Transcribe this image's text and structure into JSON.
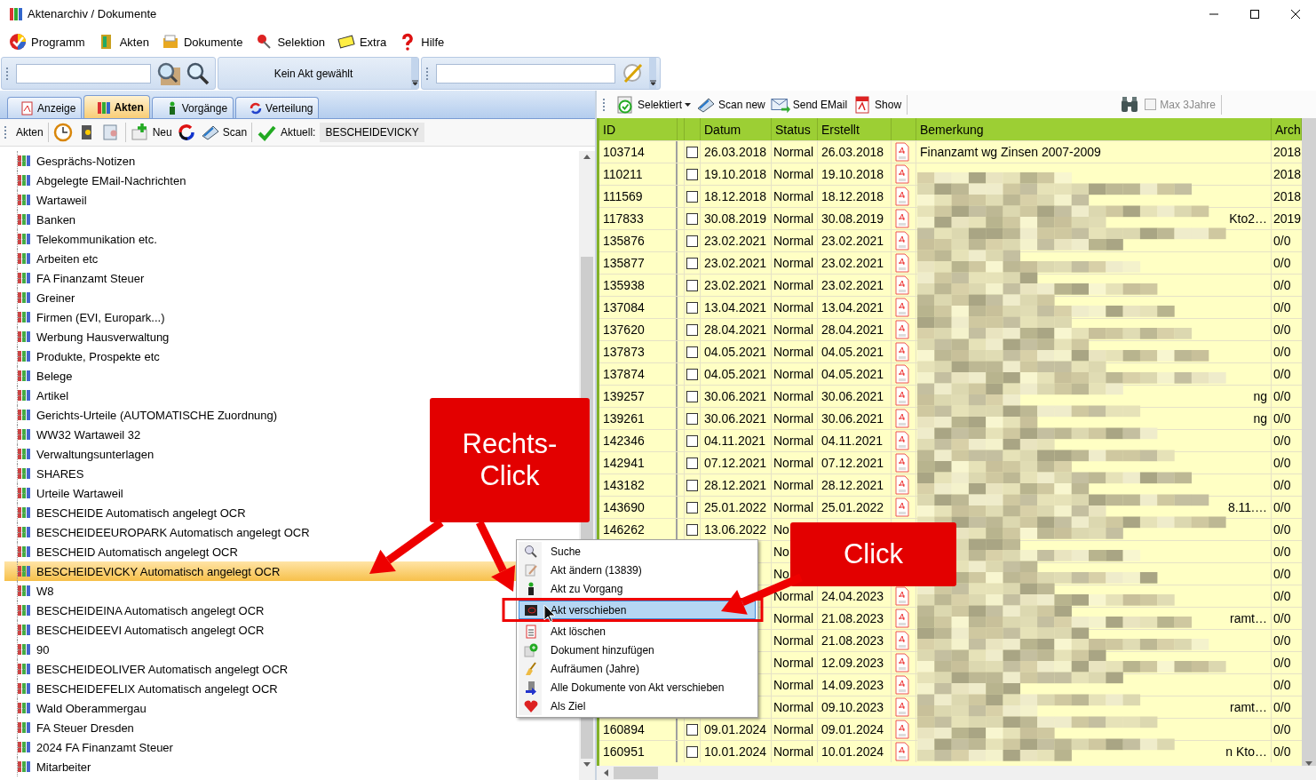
{
  "window": {
    "title": "Aktenarchiv / Dokumente"
  },
  "menu": [
    "Programm",
    "Akten",
    "Dokumente",
    "Selektion",
    "Extra",
    "Hilfe"
  ],
  "toolbar": {
    "status": "Kein Akt gewählt"
  },
  "tabs": [
    {
      "label": "Anzeige",
      "selected": false
    },
    {
      "label": "Akten",
      "selected": true
    },
    {
      "label": "Vorgänge",
      "selected": false
    },
    {
      "label": "Verteilung",
      "selected": false
    }
  ],
  "akten_toolbar": {
    "label": "Akten",
    "new": "Neu",
    "scan": "Scan",
    "current_label": "Aktuell:",
    "current_value": "BESCHEIDEVICKY"
  },
  "tree": [
    {
      "label": "Gesprächs-Notizen",
      "selected": false
    },
    {
      "label": "Abgelegte EMail-Nachrichten",
      "selected": false
    },
    {
      "label": "Wartaweil",
      "selected": false
    },
    {
      "label": "Banken",
      "selected": false
    },
    {
      "label": "Telekommunikation etc.",
      "selected": false
    },
    {
      "label": "Arbeiten etc",
      "selected": false
    },
    {
      "label": "FA Finanzamt Steuer",
      "selected": false
    },
    {
      "label": "Greiner",
      "selected": false
    },
    {
      "label": "Firmen (EVI, Europark...)",
      "selected": false
    },
    {
      "label": "Werbung Hausverwaltung",
      "selected": false
    },
    {
      "label": "Produkte, Prospekte etc",
      "selected": false
    },
    {
      "label": "Belege",
      "selected": false
    },
    {
      "label": "Artikel",
      "selected": false
    },
    {
      "label": "Gerichts-Urteile (AUTOMATISCHE Zuordnung)",
      "selected": false
    },
    {
      "label": "WW32 Wartaweil 32",
      "selected": false
    },
    {
      "label": "Verwaltungsunterlagen",
      "selected": false
    },
    {
      "label": "SHARES",
      "selected": false
    },
    {
      "label": "Urteile Wartaweil",
      "selected": false
    },
    {
      "label": "BESCHEIDE Automatisch angelegt OCR",
      "selected": false
    },
    {
      "label": "BESCHEIDEEUROPARK Automatisch angelegt OCR",
      "selected": false
    },
    {
      "label": "BESCHEID Automatisch angelegt OCR",
      "selected": false
    },
    {
      "label": "BESCHEIDEVICKY Automatisch angelegt OCR",
      "selected": true
    },
    {
      "label": "W8",
      "selected": false
    },
    {
      "label": "BESCHEIDEINA Automatisch angelegt OCR",
      "selected": false
    },
    {
      "label": "BESCHEIDEEVI Automatisch angelegt OCR",
      "selected": false
    },
    {
      "label": "90",
      "selected": false
    },
    {
      "label": "BESCHEIDEOLIVER Automatisch angelegt OCR",
      "selected": false
    },
    {
      "label": "BESCHEIDEFELIX Automatisch angelegt OCR",
      "selected": false
    },
    {
      "label": "Wald Oberammergau",
      "selected": false
    },
    {
      "label": "FA Steuer Dresden",
      "selected": false
    },
    {
      "label": "2024 FA Finanzamt Steuer",
      "selected": false
    },
    {
      "label": "Mitarbeiter",
      "selected": false
    }
  ],
  "doc_toolbar": {
    "selektiert": "Selektiert",
    "scan_new": "Scan new",
    "send_email": "Send EMail",
    "show": "Show",
    "max_3_jahre": {
      "label": "Max 3Jahre",
      "checked": false,
      "disabled": true
    }
  },
  "table": {
    "columns": [
      "ID",
      "Datum",
      "Status",
      "Erstellt",
      "Bemerkung",
      "Arch"
    ],
    "rows": [
      {
        "id": "103714",
        "checked": false,
        "datum": "26.03.2018",
        "status": "Normal",
        "erstellt": "26.03.2018",
        "pdf": true,
        "bemerkung": "Finanzamt wg Zinsen 2007-2009",
        "arch": "2018"
      },
      {
        "id": "110211",
        "checked": false,
        "datum": "19.10.2018",
        "status": "Normal",
        "erstellt": "19.10.2018",
        "pdf": true,
        "arch": "2018"
      },
      {
        "id": "111569",
        "checked": false,
        "datum": "18.12.2018",
        "status": "Normal",
        "erstellt": "18.12.2018",
        "pdf": true,
        "arch": "2018"
      },
      {
        "id": "117833",
        "checked": false,
        "datum": "30.08.2019",
        "status": "Normal",
        "erstellt": "30.08.2019",
        "pdf": true,
        "bemerkung_end": "Kto2…",
        "arch": "2019"
      },
      {
        "id": "135876",
        "checked": false,
        "datum": "23.02.2021",
        "status": "Normal",
        "erstellt": "23.02.2021",
        "pdf": true,
        "arch": "0/0"
      },
      {
        "id": "135877",
        "checked": false,
        "datum": "23.02.2021",
        "status": "Normal",
        "erstellt": "23.02.2021",
        "pdf": true,
        "arch": "0/0"
      },
      {
        "id": "135938",
        "checked": false,
        "datum": "23.02.2021",
        "status": "Normal",
        "erstellt": "23.02.2021",
        "pdf": true,
        "arch": "0/0"
      },
      {
        "id": "137084",
        "checked": false,
        "datum": "13.04.2021",
        "status": "Normal",
        "erstellt": "13.04.2021",
        "pdf": true,
        "arch": "0/0"
      },
      {
        "id": "137620",
        "checked": false,
        "datum": "28.04.2021",
        "status": "Normal",
        "erstellt": "28.04.2021",
        "pdf": true,
        "arch": "0/0"
      },
      {
        "id": "137873",
        "checked": false,
        "datum": "04.05.2021",
        "status": "Normal",
        "erstellt": "04.05.2021",
        "pdf": true,
        "arch": "0/0"
      },
      {
        "id": "137874",
        "checked": false,
        "datum": "04.05.2021",
        "status": "Normal",
        "erstellt": "04.05.2021",
        "pdf": true,
        "arch": "0/0"
      },
      {
        "id": "139257",
        "checked": false,
        "datum": "30.06.2021",
        "status": "Normal",
        "erstellt": "30.06.2021",
        "pdf": true,
        "bemerkung_end": "ng",
        "arch": "0/0"
      },
      {
        "id": "139261",
        "checked": false,
        "datum": "30.06.2021",
        "status": "Normal",
        "erstellt": "30.06.2021",
        "pdf": true,
        "bemerkung_end": "ng",
        "arch": "0/0"
      },
      {
        "id": "142346",
        "checked": false,
        "datum": "04.11.2021",
        "status": "Normal",
        "erstellt": "04.11.2021",
        "pdf": true,
        "arch": "0/0"
      },
      {
        "id": "142941",
        "checked": false,
        "datum": "07.12.2021",
        "status": "Normal",
        "erstellt": "07.12.2021",
        "pdf": true,
        "arch": "0/0"
      },
      {
        "id": "143182",
        "checked": false,
        "datum": "28.12.2021",
        "status": "Normal",
        "erstellt": "28.12.2021",
        "pdf": true,
        "arch": "0/0"
      },
      {
        "id": "143690",
        "checked": false,
        "datum": "25.01.2022",
        "status": "Normal",
        "erstellt": "25.01.2022",
        "pdf": true,
        "bemerkung_end": "8.11.…",
        "arch": "0/0"
      },
      {
        "id": "146262",
        "checked": false,
        "datum": "13.06.2022",
        "status": "No",
        "pdf": false,
        "arch": "0/0"
      },
      {
        "status": "No",
        "pdf": false,
        "arch": "0/0"
      },
      {
        "status": "No",
        "pdf": false,
        "arch": "0/0"
      },
      {
        "status": "Normal",
        "erstellt": "24.04.2023",
        "pdf": true,
        "arch": "0/0"
      },
      {
        "status": "Normal",
        "erstellt": "21.08.2023",
        "pdf": true,
        "bemerkung_end": "ramt…",
        "arch": "0/0"
      },
      {
        "status": "Normal",
        "erstellt": "21.08.2023",
        "pdf": true,
        "arch": "0/0"
      },
      {
        "status": "Normal",
        "erstellt": "12.09.2023",
        "pdf": true,
        "arch": "0/0"
      },
      {
        "status": "Normal",
        "erstellt": "14.09.2023",
        "pdf": true,
        "arch": "0/0"
      },
      {
        "status": "Normal",
        "erstellt": "09.10.2023",
        "pdf": true,
        "bemerkung_end": "ramt…",
        "arch": "0/0"
      },
      {
        "id": "160894",
        "checked": false,
        "datum": "09.01.2024",
        "status": "Normal",
        "erstellt": "09.01.2024",
        "pdf": true,
        "arch": "0/0"
      },
      {
        "id": "160951",
        "checked": false,
        "datum": "10.01.2024",
        "status": "Normal",
        "erstellt": "10.01.2024",
        "pdf": true,
        "bemerkung_end": "n Kto…",
        "arch": "0/0"
      }
    ]
  },
  "context_menu": [
    {
      "label": "Suche",
      "selected": false
    },
    {
      "label": "Akt ändern (13839)",
      "selected": false
    },
    {
      "label": "Akt zu Vorgang",
      "selected": false
    },
    {
      "label": "Akt verschieben",
      "selected": true
    },
    {
      "label": "Akt löschen",
      "selected": false
    },
    {
      "label": "Dokument hinzufügen",
      "selected": false
    },
    {
      "label": "Aufräumen (Jahre)",
      "selected": false
    },
    {
      "label": "Alle Dokumente von Akt verschieben",
      "selected": false
    },
    {
      "label": "Als Ziel",
      "selected": false
    }
  ],
  "annotations": [
    "Rechts-Click",
    "Click"
  ]
}
